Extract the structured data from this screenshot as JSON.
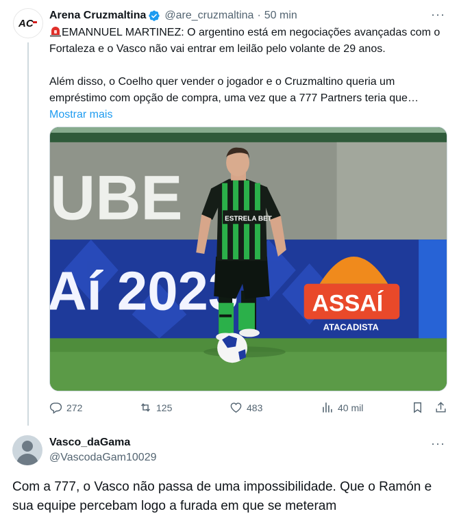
{
  "tweet": {
    "author_name": "Arena Cruzmaltina",
    "handle": "@are_cruzmaltina",
    "separator": "·",
    "time": "50 min",
    "more_label": "···",
    "avatar_text": "AC",
    "line1": "EMANNUEL MARTINEZ: O argentino está em negociações avançadas com o Fortaleza e o Vasco não vai entrar em leilão pelo volante de 29 anos.",
    "line2": "Além disso, o Coelho quer vender o jogador e o Cruzmaltino queria um empréstimo com opção de compra, uma vez que a 777 Partners teria que…",
    "show_more": "Mostrar mais",
    "image": {
      "banner_text": "UBE",
      "ad_text": "Aí 2023",
      "sponsor_main": "ASSAÍ",
      "sponsor_sub": "ATACADISTA",
      "jersey_text": "ESTRELA BET"
    },
    "actions": {
      "replies": "272",
      "retweets": "125",
      "likes": "483",
      "views": "40 mil"
    }
  },
  "reply": {
    "author_name": "Vasco_daGama",
    "handle": "@VascodaGam10029",
    "more_label": "···",
    "text": "Com a 777, o Vasco não passa de uma impossibilidade. Que o Ramón e sua equipe percebam logo a furada em que se meteram"
  },
  "colors": {
    "accent": "#1d9bf0",
    "secondary_text": "#536471",
    "primary_text": "#0f1419",
    "divider": "#cfd9de"
  },
  "icons": [
    "ac-logo-icon",
    "verified-badge-icon",
    "siren-emoji-icon",
    "more-icon",
    "reply-icon",
    "retweet-icon",
    "like-icon",
    "views-icon",
    "bookmark-icon",
    "share-icon",
    "default-avatar-icon"
  ]
}
